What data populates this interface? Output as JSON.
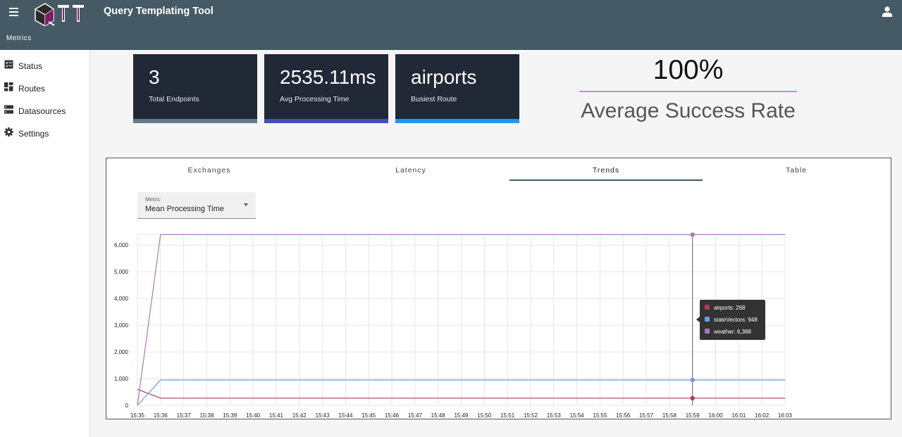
{
  "header": {
    "title": "Query Templating Tool",
    "subtitle": "Metrics",
    "logo_text": "QTT"
  },
  "sidebar": {
    "items": [
      {
        "label": "Status",
        "icon": "status-icon"
      },
      {
        "label": "Routes",
        "icon": "dashboard-icon"
      },
      {
        "label": "Datasources",
        "icon": "storage-icon"
      },
      {
        "label": "Settings",
        "icon": "gear-icon"
      }
    ]
  },
  "cards": [
    {
      "value": "3",
      "caption": "Total Endpoints",
      "color": "#607d8b"
    },
    {
      "value": "2535.11ms",
      "caption": "Avg Processing Time",
      "color": "#3f51b5"
    },
    {
      "value": "airports",
      "caption": "Busiest Route",
      "color": "#2196f3"
    }
  ],
  "success_rate": {
    "value": "100%",
    "caption": "Average Success Rate"
  },
  "tabs": [
    {
      "label": "Exchanges",
      "active": false
    },
    {
      "label": "Latency",
      "active": false
    },
    {
      "label": "Trends",
      "active": true
    },
    {
      "label": "Table",
      "active": false
    }
  ],
  "metric_select": {
    "label": "Metric",
    "value": "Mean Processing Time"
  },
  "tooltip": {
    "rows": [
      {
        "text": "airports: 268",
        "color": "#b03a5b"
      },
      {
        "text": "stateVectors: 948",
        "color": "#6b9be8"
      },
      {
        "text": "weather: 6,388",
        "color": "#a87ab4"
      }
    ]
  },
  "chart_data": {
    "type": "line",
    "x": [
      "15:35",
      "15:36",
      "15:37",
      "15:38",
      "15:39",
      "15:40",
      "15:41",
      "15:42",
      "15:43",
      "15:44",
      "15:45",
      "15:46",
      "15:47",
      "15:48",
      "15:49",
      "15:50",
      "15:51",
      "15:52",
      "15:53",
      "15:54",
      "15:55",
      "15:56",
      "15:57",
      "15:58",
      "15:59",
      "16:00",
      "16:01",
      "16:02",
      "16:03"
    ],
    "yticks": [
      0,
      1000,
      2000,
      3000,
      4000,
      5000,
      6000
    ],
    "ytick_labels": [
      "0",
      "1,000",
      "2,000",
      "3,000",
      "4,000",
      "5,000",
      "6,000"
    ],
    "ylim": [
      0,
      6400
    ],
    "grid": true,
    "legend": "none",
    "hover_index": 24,
    "series": [
      {
        "name": "airports",
        "color": "#b03a5b",
        "values": [
          600,
          268,
          268,
          268,
          268,
          268,
          268,
          268,
          268,
          268,
          268,
          268,
          268,
          268,
          268,
          268,
          268,
          268,
          268,
          268,
          268,
          268,
          268,
          268,
          268,
          268,
          268,
          268,
          268
        ]
      },
      {
        "name": "stateVectors",
        "color": "#6b9be8",
        "values": [
          0,
          948,
          948,
          948,
          948,
          948,
          948,
          948,
          948,
          948,
          948,
          948,
          948,
          948,
          948,
          948,
          948,
          948,
          948,
          948,
          948,
          948,
          948,
          948,
          948,
          948,
          948,
          948,
          948
        ]
      },
      {
        "name": "weather",
        "color": "#a87ab4",
        "values": [
          0,
          6388,
          6388,
          6388,
          6388,
          6388,
          6388,
          6388,
          6388,
          6388,
          6388,
          6388,
          6388,
          6388,
          6388,
          6388,
          6388,
          6388,
          6388,
          6388,
          6388,
          6388,
          6388,
          6388,
          6388,
          6388,
          6388,
          6388,
          6388
        ]
      }
    ]
  }
}
